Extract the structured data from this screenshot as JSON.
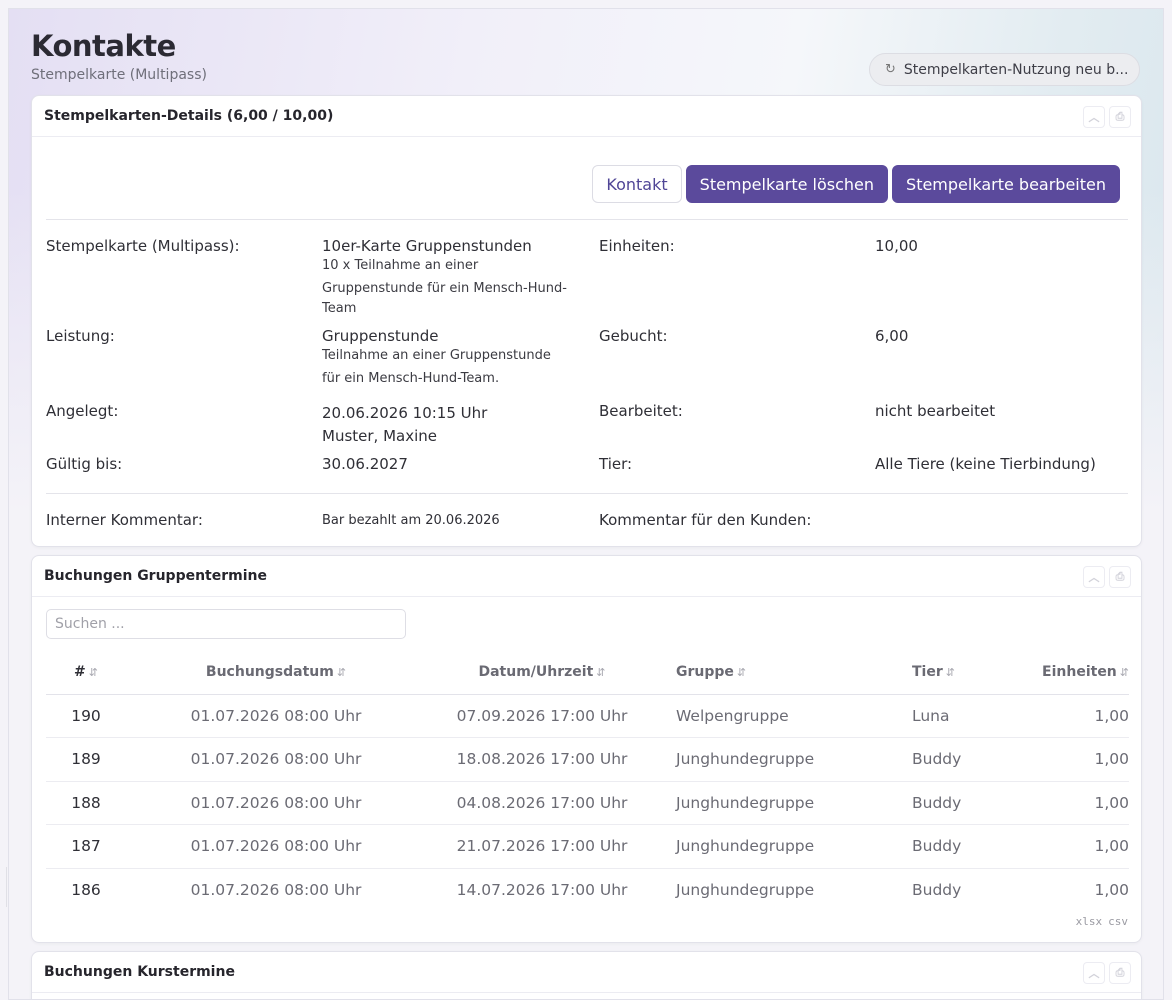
{
  "header": {
    "title": "Kontakte",
    "subtitle": "Stempelkarte (Multipass)",
    "recalc_label": "Stempelkarten-Nutzung neu b..."
  },
  "details_card": {
    "title": "Stempelkarten-Details (6,00 / 10,00)",
    "buttons": {
      "contact": "Kontakt",
      "delete": "Stempelkarte löschen",
      "edit": "Stempelkarte bearbeiten"
    },
    "fields": {
      "card_label": "Stempelkarte (Multipass):",
      "card_value": "10er-Karte Gruppenstunden",
      "card_desc_1": "10 x Teilnahme an einer",
      "card_desc_2": "Gruppenstunde für ein Mensch-Hund-",
      "card_desc_3": "Team",
      "units_label": "Einheiten:",
      "units_value": "10,00",
      "service_label": "Leistung:",
      "service_value": "Gruppenstunde",
      "service_desc_1": "Teilnahme an einer Gruppenstunde",
      "service_desc_2": "für ein Mensch-Hund-Team.",
      "booked_label": "Gebucht:",
      "booked_value": "6,00",
      "created_label": "Angelegt:",
      "created_value": "20.06.2026 10:15 Uhr",
      "created_by": "Muster, Maxine",
      "edited_label": "Bearbeitet:",
      "edited_value": "nicht bearbeitet",
      "valid_label": "Gültig bis:",
      "valid_value": "30.06.2027",
      "animal_label": "Tier:",
      "animal_value": "Alle Tiere (keine Tierbindung)",
      "internal_comment_label": "Interner Kommentar:",
      "internal_comment_value": "Bar bezahlt am 20.06.2026",
      "customer_comment_label": "Kommentar für den Kunden:"
    }
  },
  "group_bookings": {
    "title": "Buchungen Gruppentermine",
    "search_placeholder": "Suchen ...",
    "columns": [
      "#",
      "Buchungsdatum",
      "Datum/Uhrzeit",
      "Gruppe",
      "Tier",
      "Einheiten"
    ],
    "rows": [
      [
        "190",
        "01.07.2026 08:00 Uhr",
        "07.09.2026 17:00 Uhr",
        "Welpengruppe",
        "Luna",
        "1,00"
      ],
      [
        "189",
        "01.07.2026 08:00 Uhr",
        "18.08.2026 17:00 Uhr",
        "Junghundegruppe",
        "Buddy",
        "1,00"
      ],
      [
        "188",
        "01.07.2026 08:00 Uhr",
        "04.08.2026 17:00 Uhr",
        "Junghundegruppe",
        "Buddy",
        "1,00"
      ],
      [
        "187",
        "01.07.2026 08:00 Uhr",
        "21.07.2026 17:00 Uhr",
        "Junghundegruppe",
        "Buddy",
        "1,00"
      ],
      [
        "186",
        "01.07.2026 08:00 Uhr",
        "14.07.2026 17:00 Uhr",
        "Junghundegruppe",
        "Buddy",
        "1,00"
      ]
    ],
    "export": [
      "xlsx",
      "csv"
    ]
  },
  "course_bookings": {
    "title": "Buchungen Kurstermine"
  },
  "colors": {
    "primary": "#5b4a9c",
    "outline_text": "#4f4596"
  }
}
